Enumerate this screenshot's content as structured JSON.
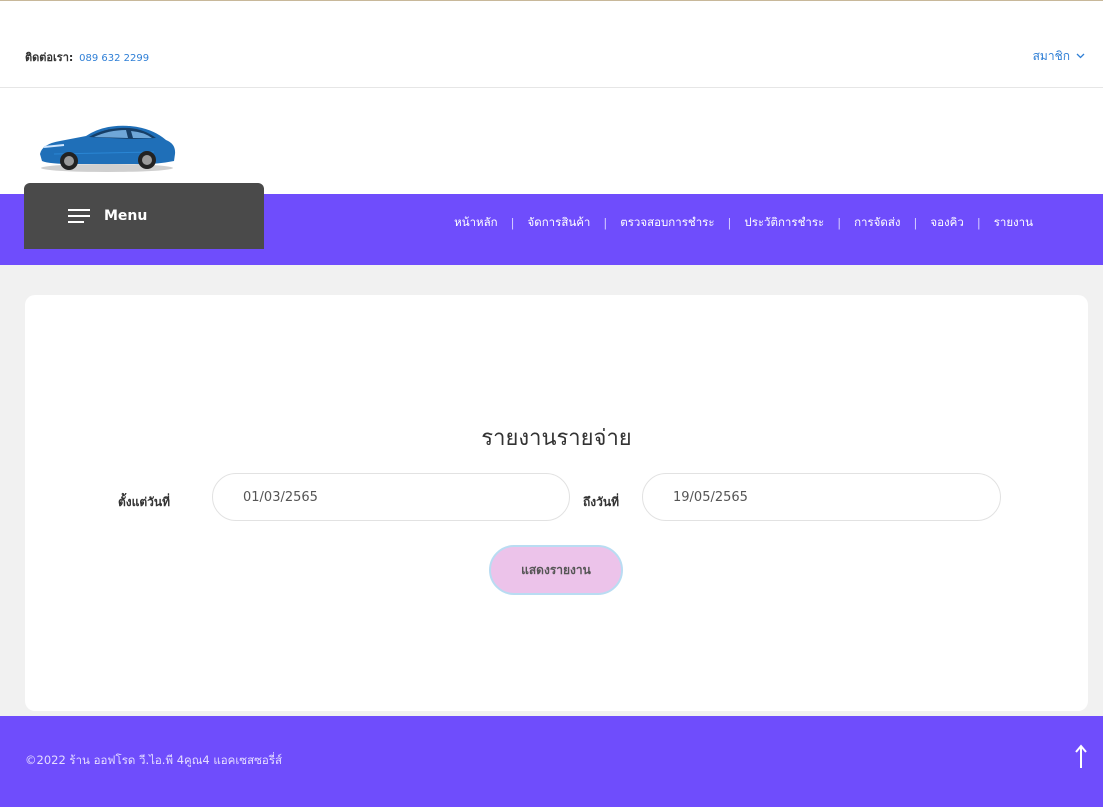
{
  "topbar": {
    "contact_label": "ติดต่อเรา:",
    "contact_phone": "089 632 2299",
    "member_label": "สมาชิก"
  },
  "menu": {
    "label": "Menu"
  },
  "nav": {
    "items": [
      {
        "label": "หน้าหลัก"
      },
      {
        "label": "จัดการสินค้า"
      },
      {
        "label": "ตรวจสอบการชำระ"
      },
      {
        "label": "ประวัติการชำระ"
      },
      {
        "label": "การจัดส่ง"
      },
      {
        "label": "จองคิว"
      },
      {
        "label": "รายงาน"
      }
    ]
  },
  "report": {
    "title": "รายงานรายจ่าย",
    "from_label": "ตั้งแต่วันที่",
    "from_value": "01/03/2565",
    "to_label": "ถึงวันที่",
    "to_value": "19/05/2565",
    "submit_label": "แสดงรายงาน"
  },
  "footer": {
    "copyright": "©2022 ร้าน ออฟโรด วี.ไอ.พี 4คูณ4 แอคเซสซอรี่ส์"
  },
  "colors": {
    "nav_bg": "#6f4dfc",
    "menu_bg": "#4a4a4a",
    "button_bg": "#ecc3ea",
    "link": "#2f7fd6"
  },
  "icons": [
    "hamburger-icon",
    "chevron-down-icon",
    "car-logo",
    "arrow-up-icon"
  ]
}
